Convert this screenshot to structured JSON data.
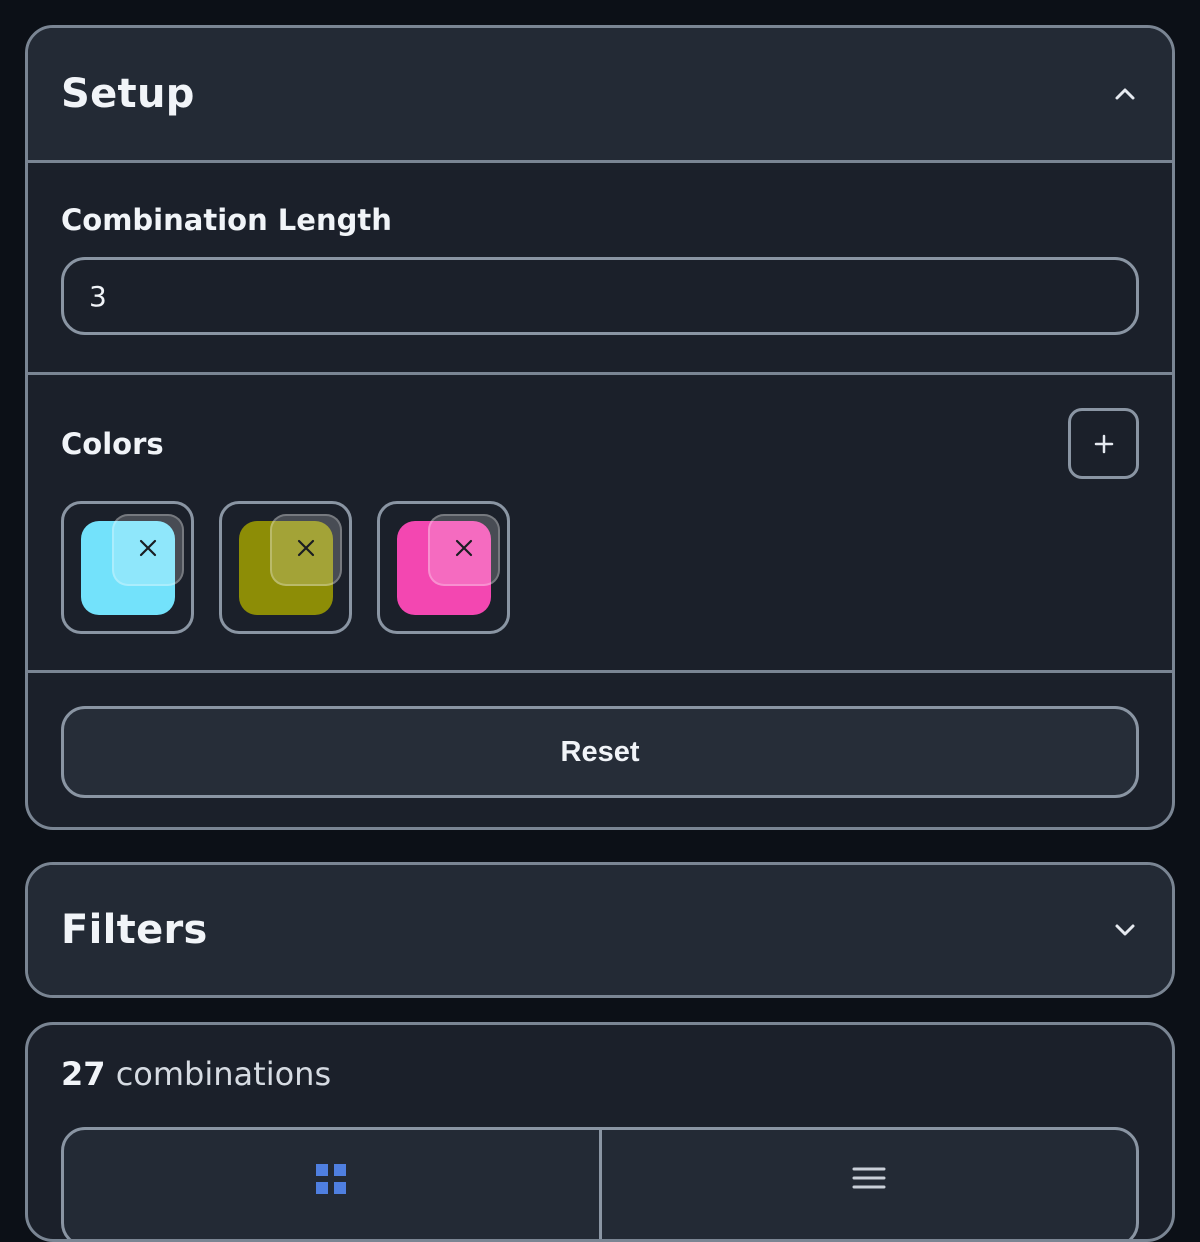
{
  "setup": {
    "title": "Setup",
    "length_label": "Combination Length",
    "length_value": "3",
    "colors_label": "Colors",
    "colors": [
      {
        "hex": "#73e2fb"
      },
      {
        "hex": "#8d8d06"
      },
      {
        "hex": "#f347b1"
      }
    ],
    "reset_label": "Reset"
  },
  "filters": {
    "title": "Filters"
  },
  "results": {
    "count": "27",
    "count_suffix": "combinations",
    "view_modes": [
      "grid-icon",
      "list-icon"
    ],
    "accent": "#4f7fe0"
  }
}
